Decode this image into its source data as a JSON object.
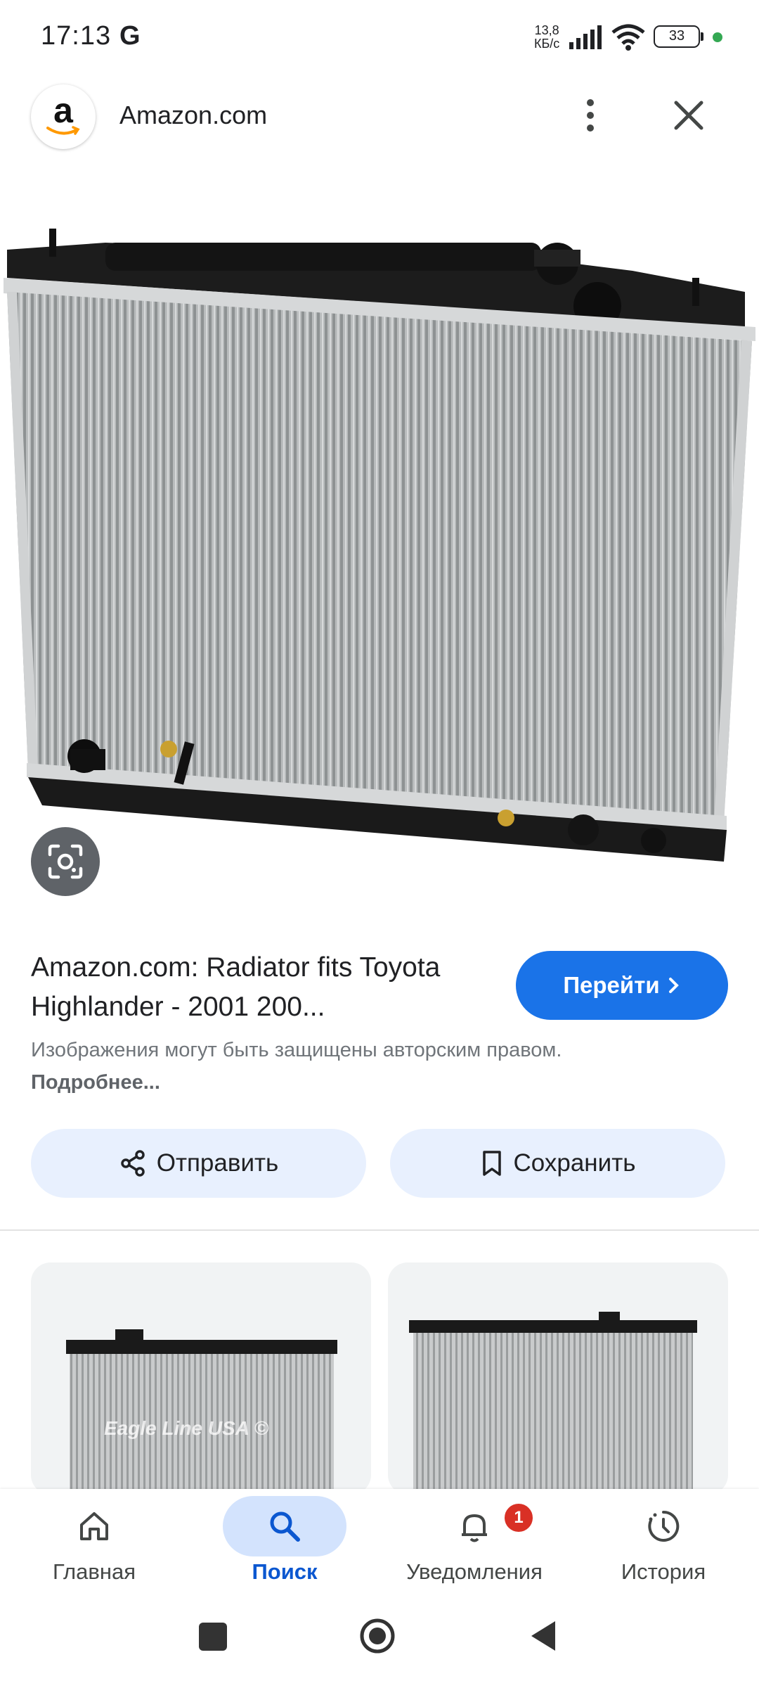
{
  "status_bar": {
    "time": "17:13",
    "g_indicator": "G",
    "net_speed_value": "13,8",
    "net_speed_unit": "КБ/с",
    "battery": "33"
  },
  "header": {
    "logo_letter": "a",
    "site_name": "Amazon.com",
    "more_icon": "more-vert-icon",
    "close_icon": "close-icon"
  },
  "main": {
    "image_subject": "radiator",
    "lens_icon": "google-lens-icon",
    "title": "Amazon.com: Radiator fits Toyota Highlander - 2001 200...",
    "visit_label": "Перейти",
    "copyright_text": "Изображения могут быть защищены авторским правом.",
    "copyright_more": "Подробнее...",
    "share_label": "Отправить",
    "save_label": "Сохранить"
  },
  "related": {
    "card1_watermark": "Eagle Line USA ©"
  },
  "bottom_nav": {
    "items": [
      {
        "label": "Главная",
        "icon": "home-icon"
      },
      {
        "label": "Поиск",
        "icon": "search-icon",
        "active": true
      },
      {
        "label": "Уведомления",
        "icon": "bell-icon",
        "badge": "1"
      },
      {
        "label": "История",
        "icon": "history-icon"
      }
    ]
  },
  "colors": {
    "accent": "#1a73e8",
    "pill_bg": "#e8f0fe",
    "active_nav_bg": "#d3e3fd",
    "badge": "#d93025"
  }
}
